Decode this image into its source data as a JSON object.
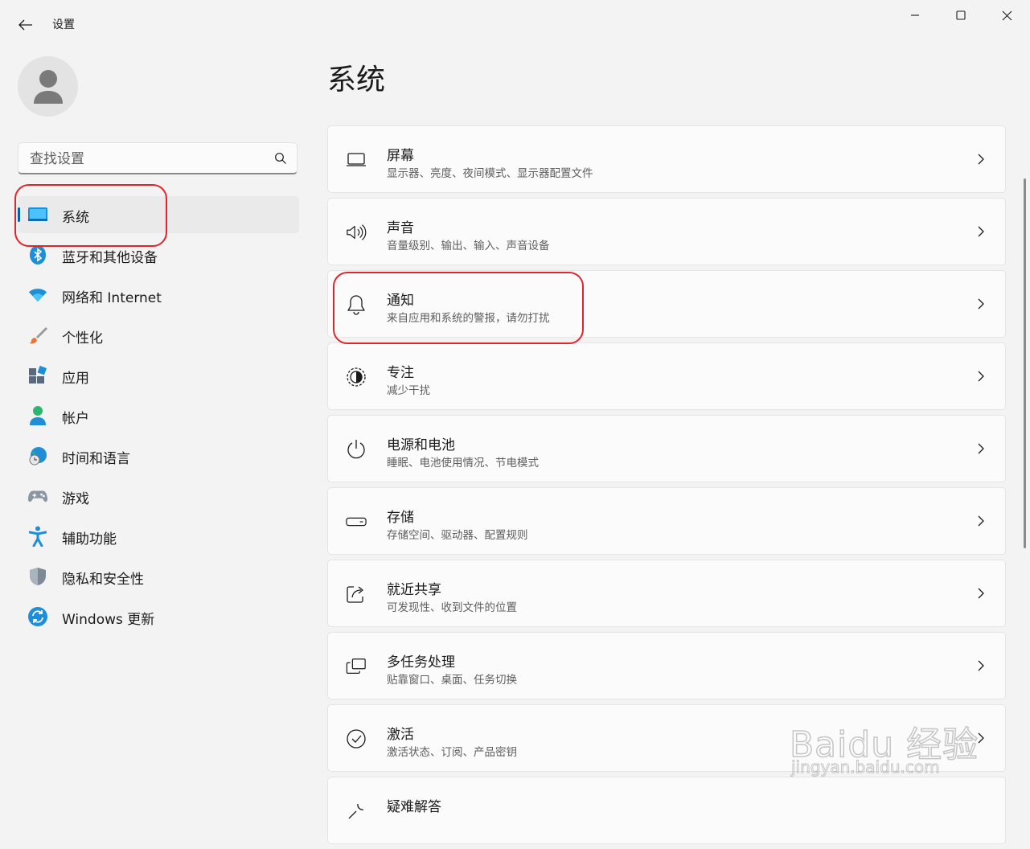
{
  "app": {
    "title": "设置"
  },
  "search": {
    "placeholder": "查找设置"
  },
  "sidebar": {
    "items": [
      {
        "label": "系统"
      },
      {
        "label": "蓝牙和其他设备"
      },
      {
        "label": "网络和 Internet"
      },
      {
        "label": "个性化"
      },
      {
        "label": "应用"
      },
      {
        "label": "帐户"
      },
      {
        "label": "时间和语言"
      },
      {
        "label": "游戏"
      },
      {
        "label": "辅助功能"
      },
      {
        "label": "隐私和安全性"
      },
      {
        "label": "Windows 更新"
      }
    ]
  },
  "main": {
    "title": "系统",
    "cards": [
      {
        "title": "屏幕",
        "subtitle": "显示器、亮度、夜间模式、显示器配置文件"
      },
      {
        "title": "声音",
        "subtitle": "音量级别、输出、输入、声音设备"
      },
      {
        "title": "通知",
        "subtitle": "来自应用和系统的警报，请勿打扰"
      },
      {
        "title": "专注",
        "subtitle": "减少干扰"
      },
      {
        "title": "电源和电池",
        "subtitle": "睡眠、电池使用情况、节电模式"
      },
      {
        "title": "存储",
        "subtitle": "存储空间、驱动器、配置规则"
      },
      {
        "title": "就近共享",
        "subtitle": "可发现性、收到文件的位置"
      },
      {
        "title": "多任务处理",
        "subtitle": "贴靠窗口、桌面、任务切换"
      },
      {
        "title": "激活",
        "subtitle": "激活状态、订阅、产品密钥"
      },
      {
        "title": "疑难解答",
        "subtitle": ""
      }
    ]
  },
  "watermark": {
    "brand": "Baidu 经验",
    "url": "jingyan.baidu.com"
  },
  "colors": {
    "accent": "#005fb8",
    "annotation": "#e0252c",
    "background": "#f3f3f3",
    "card": "#fbfbfb"
  }
}
